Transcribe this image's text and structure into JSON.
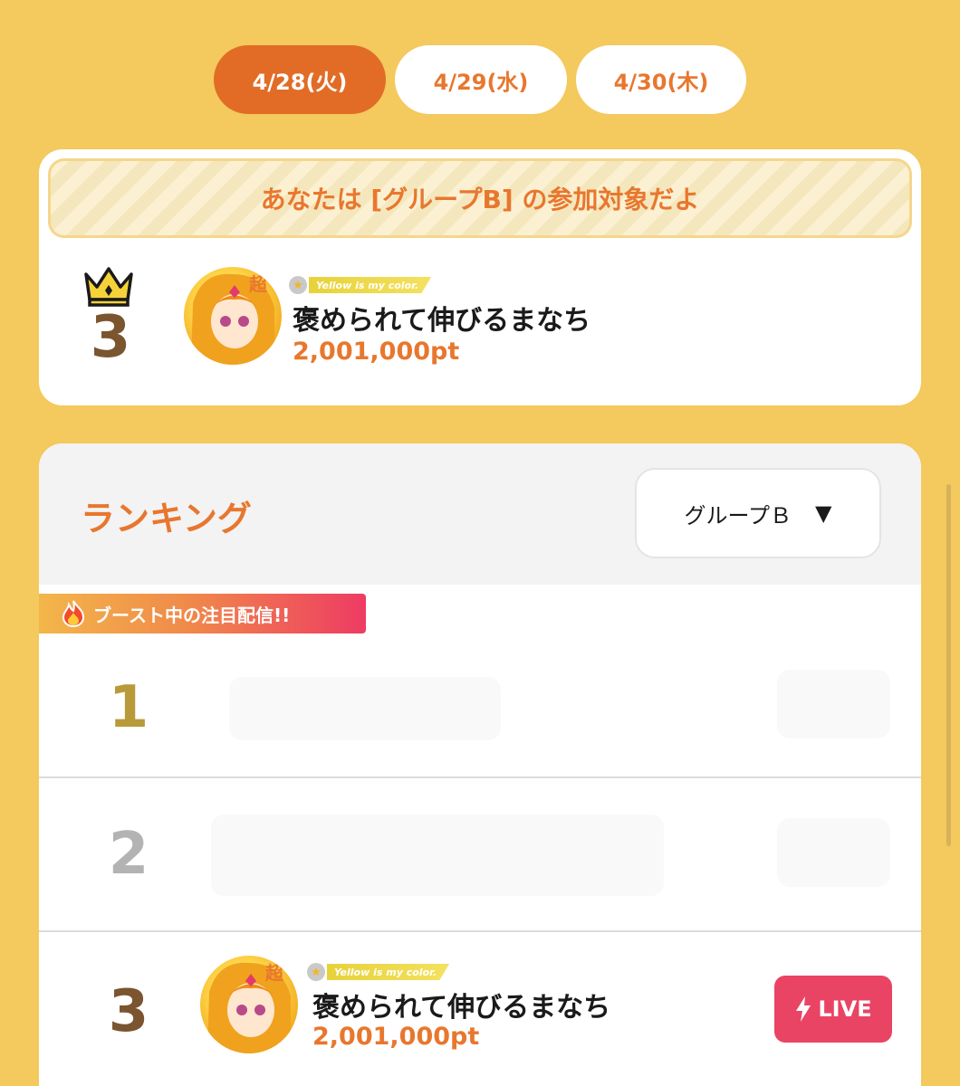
{
  "date_tabs": [
    {
      "label": "4/28(火)",
      "active": true
    },
    {
      "label": "4/29(水)",
      "active": false
    },
    {
      "label": "4/30(木)",
      "active": false
    }
  ],
  "my_card": {
    "group_banner": "あなたは [グループB] の参加対象だよ",
    "rank": "3",
    "avatar_mark": "超",
    "tag": "Yellow is my color.",
    "name": "褒められて伸びるまなち",
    "points": "2,001,000pt"
  },
  "ranking": {
    "title": "ランキング",
    "group_select": "グループＢ",
    "caret": "▼",
    "boost_label": "ブースト中の注目配信!!",
    "rows": [
      {
        "rank": "1"
      },
      {
        "rank": "2"
      },
      {
        "rank": "3",
        "avatar_mark": "超",
        "tag": "Yellow is my color.",
        "name": "褒められて伸びるまなち",
        "points": "2,001,000pt",
        "live_label": "LIVE"
      }
    ]
  },
  "colors": {
    "background": "#f4c95d",
    "accent": "#e8772e",
    "active_tab": "#e26c26",
    "live": "#e94464"
  },
  "icons": [
    "crown-icon",
    "fire-icon",
    "bolt-icon",
    "star-icon"
  ]
}
